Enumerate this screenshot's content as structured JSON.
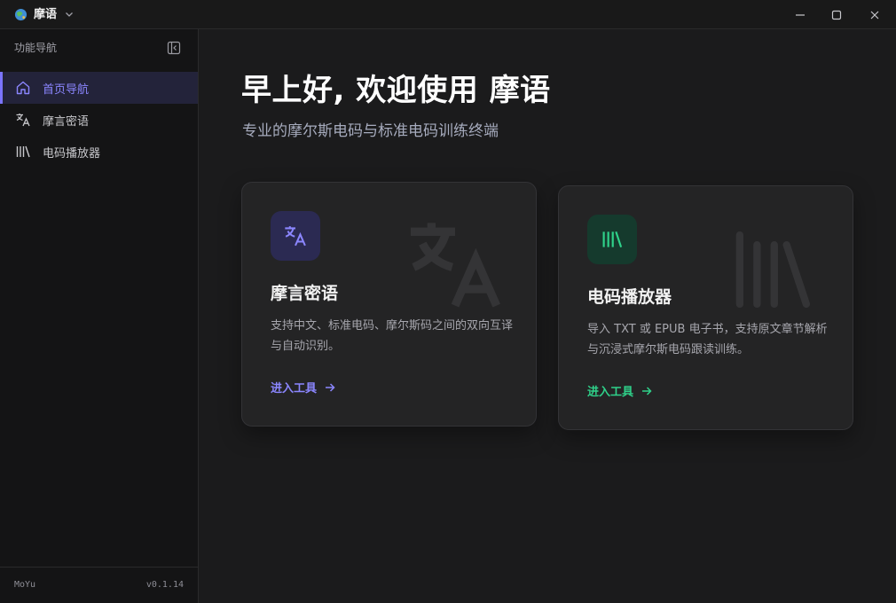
{
  "titlebar": {
    "app_name": "摩语",
    "logo_icon": "globe-icon",
    "window_controls": [
      "minimize-icon",
      "maximize-icon",
      "close-icon"
    ]
  },
  "sidebar": {
    "header": "功能导航",
    "collapse_icon": "sidebar-collapse-icon",
    "items": [
      {
        "label": "首页导航",
        "icon": "home-icon",
        "active": true
      },
      {
        "label": "摩言密语",
        "icon": "translate-icon",
        "active": false
      },
      {
        "label": "电码播放器",
        "icon": "library-icon",
        "active": false
      }
    ],
    "footer": {
      "app": "MoYu",
      "version": "v0.1.14"
    }
  },
  "main": {
    "greeting": "早上好, 欢迎使用 摩语",
    "subtitle": "专业的摩尔斯电码与标准电码训练终端",
    "cards": [
      {
        "title": "摩言密语",
        "description": "支持中文、标准电码、摩尔斯码之间的双向互译与自动识别。",
        "link": "进入工具",
        "icon": "translate-icon",
        "accent": "#8b86ff"
      },
      {
        "title": "电码播放器",
        "description": "导入 TXT 或 EPUB 电子书，支持原文章节解析与沉浸式摩尔斯电码跟读训练。",
        "link": "进入工具",
        "icon": "library-icon",
        "accent": "#2fd18a"
      }
    ]
  },
  "colors": {
    "accent_primary": "#7b74ff",
    "accent_green": "#2fd18a",
    "background": "#1b1b1c",
    "sidebar_bg": "#141415",
    "card_bg": "#242425"
  }
}
